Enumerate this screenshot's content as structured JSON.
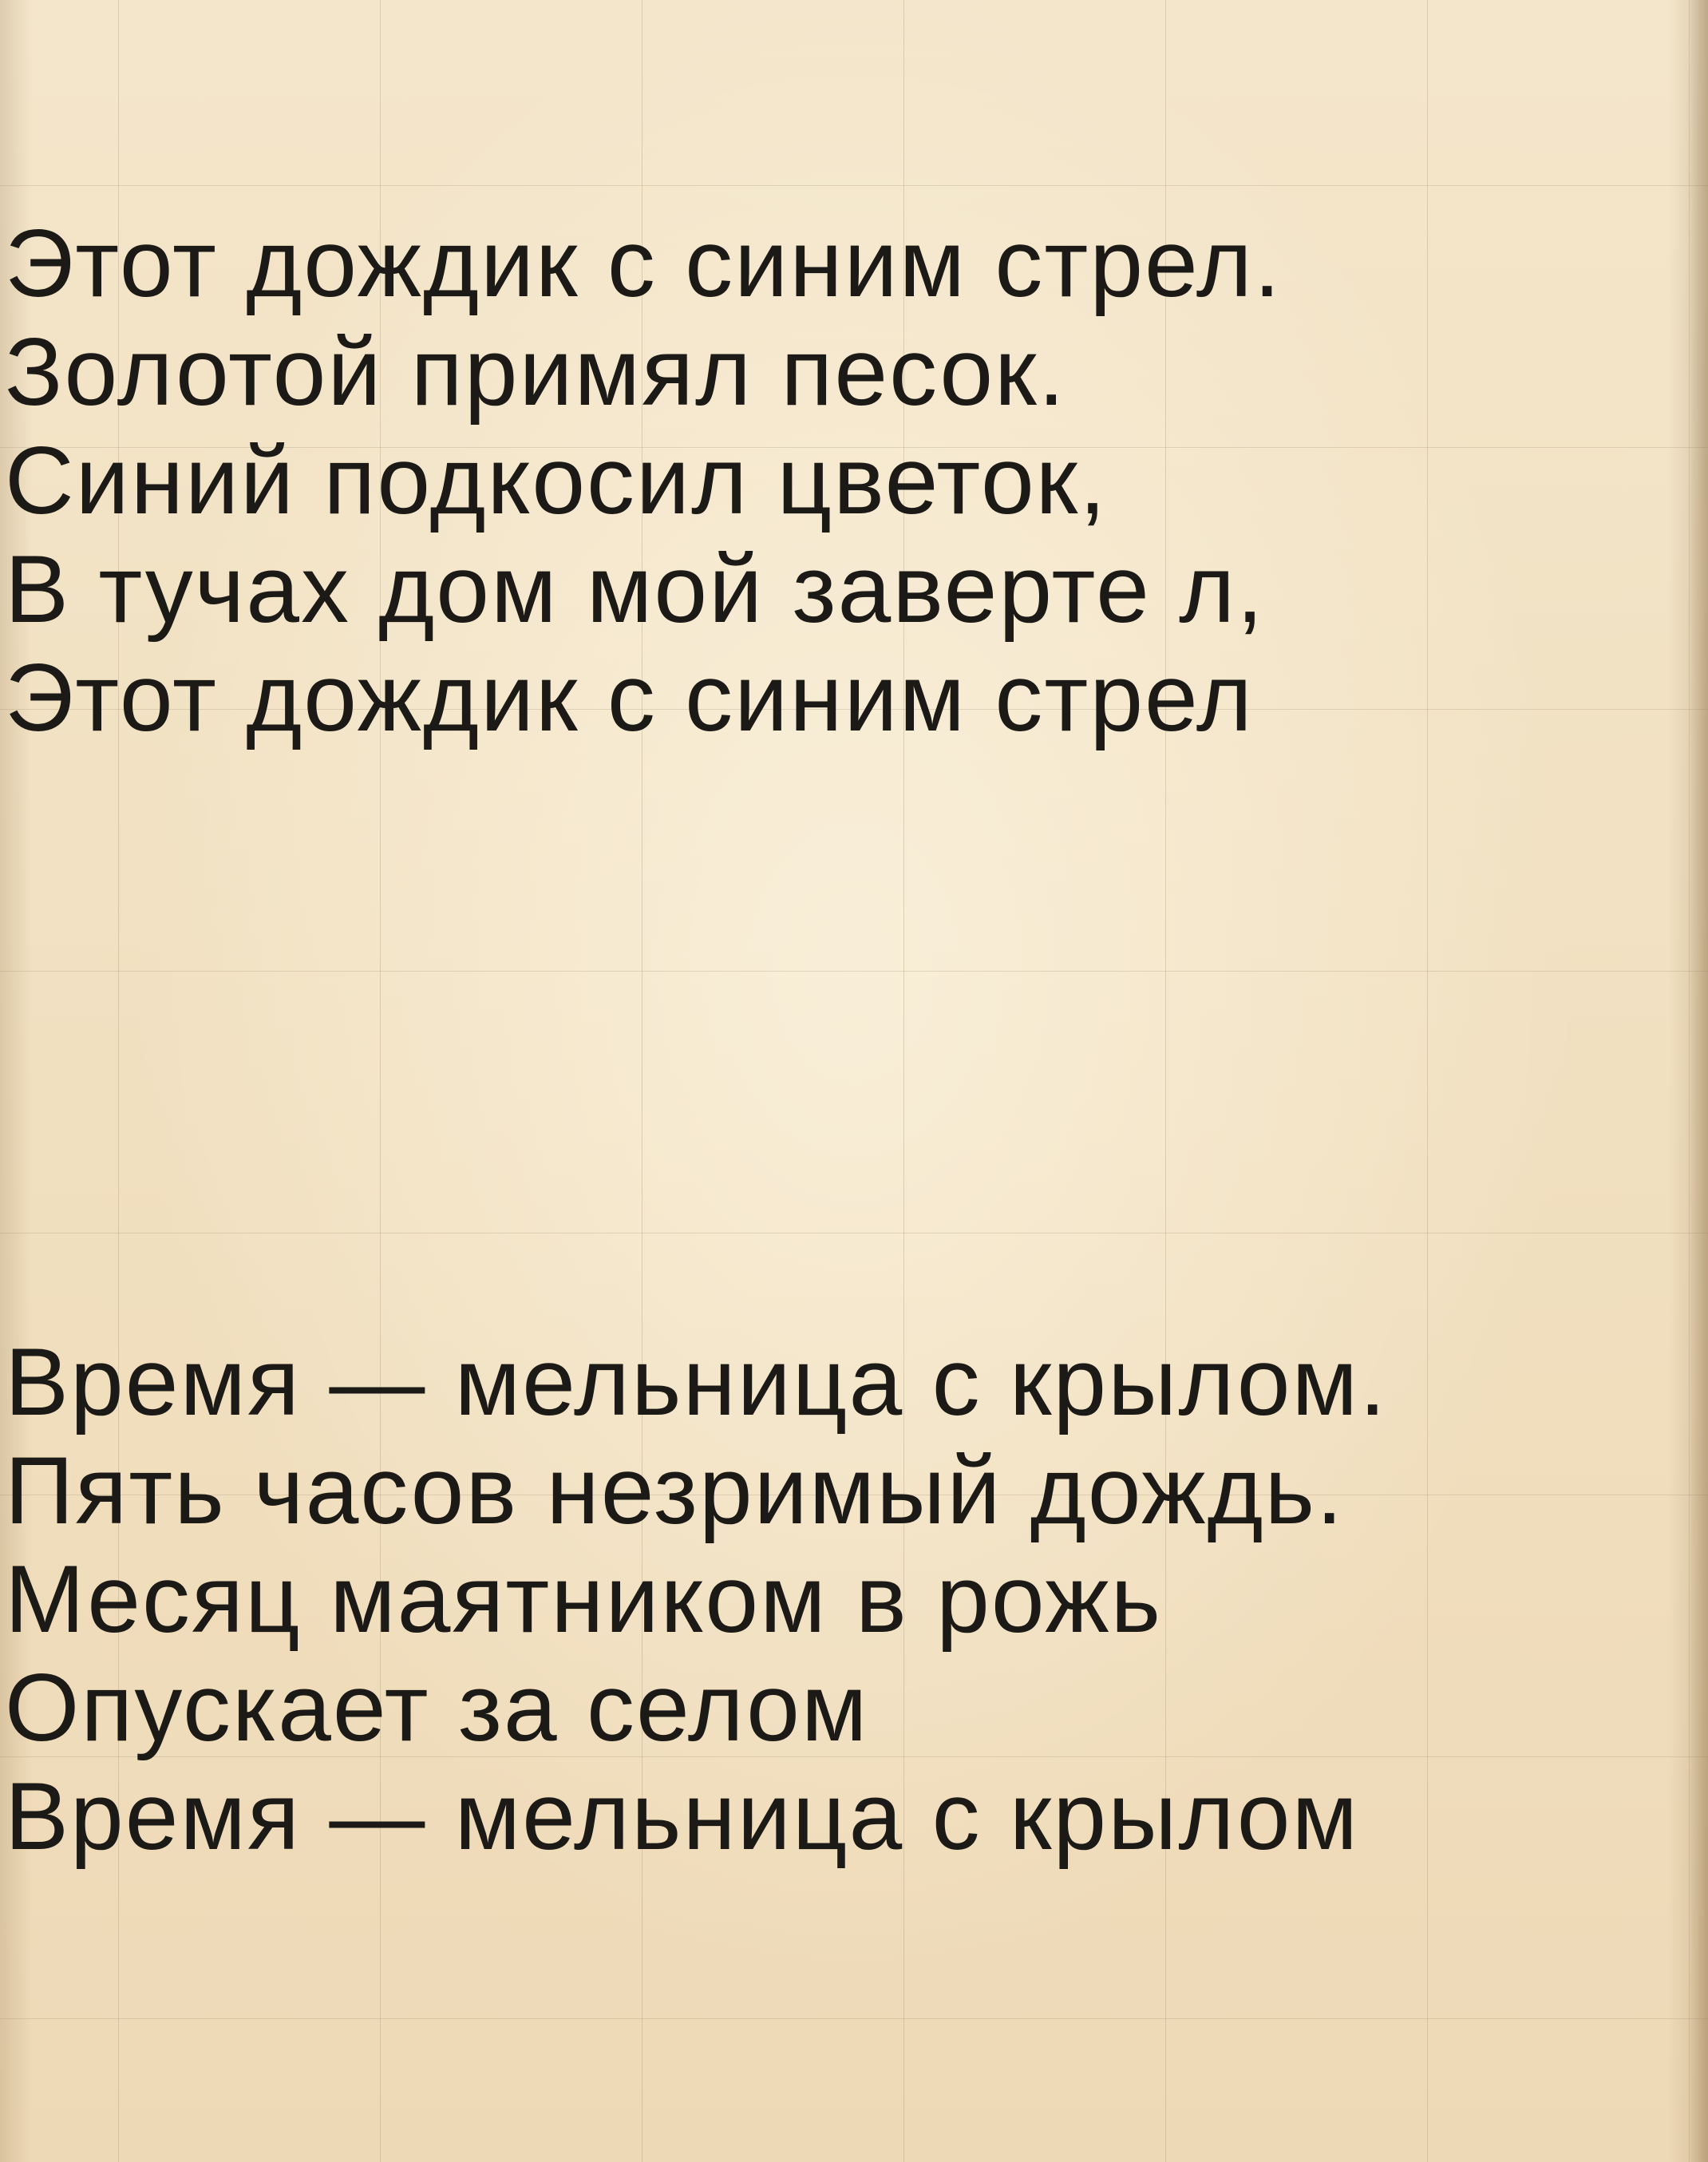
{
  "stanzas": [
    {
      "lines": [
        "Этот дождик с синим стрел.",
        "Золотой примял песок.",
        "Синий подкосил цветок,",
        "В тучах дом мой заверте л,",
        "Этот дождик с синим стрел"
      ]
    },
    {
      "lines": [
        "Время — мельница с крылом.",
        "Пять часов незримый дождь.",
        "Месяц маятником в рожь",
        "Опускает за селом",
        "Время — мельница с крылом"
      ]
    }
  ]
}
